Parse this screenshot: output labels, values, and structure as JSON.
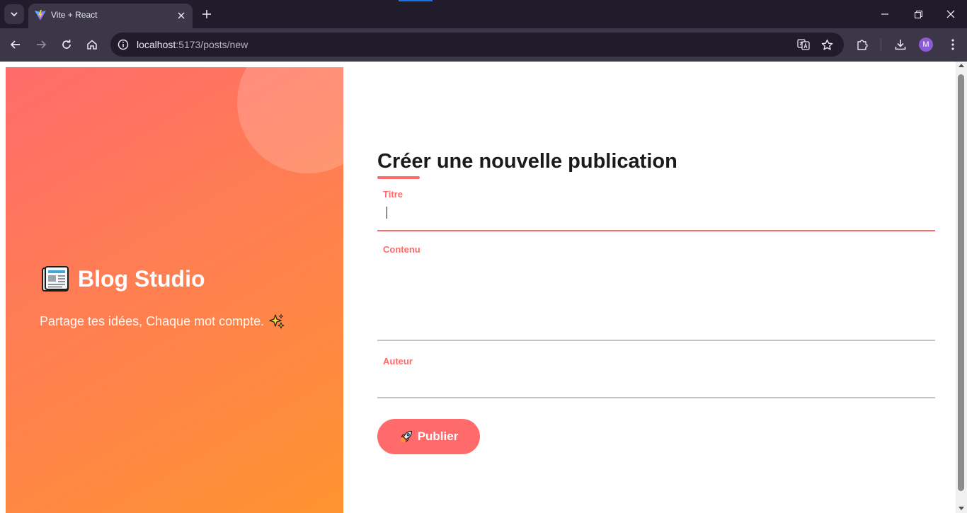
{
  "browser": {
    "tab_title": "Vite + React",
    "url_host": "localhost",
    "url_path": ":5173/posts/new",
    "profile_initial": "M"
  },
  "hero": {
    "title": "Blog Studio",
    "subtitle": "Partage tes idées, Chaque mot compte.",
    "gradient_start": "#ff6b6b",
    "gradient_end": "#ff9330"
  },
  "form": {
    "heading": "Créer une nouvelle publication",
    "accent_color": "#ff6b6b",
    "fields": {
      "title_label": "Titre",
      "title_value": "",
      "content_label": "Contenu",
      "content_value": "",
      "author_label": "Auteur",
      "author_value": ""
    },
    "submit_label": "Publier"
  },
  "icons": [
    "vite-logo-icon",
    "newspaper-icon",
    "sparkle-icon",
    "rocket-icon"
  ]
}
